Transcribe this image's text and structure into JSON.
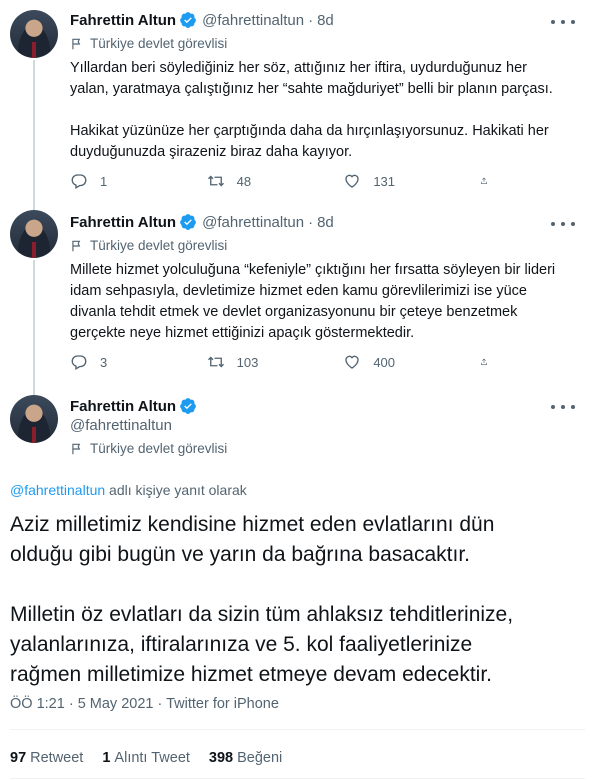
{
  "tweets": [
    {
      "name": "Fahrettin Altun",
      "handle": "@fahrettinaltun",
      "separator": "·",
      "time": "8d",
      "label": "Türkiye devlet görevlisi",
      "text": "Yıllardan beri söylediğiniz her söz, attığınız her iftira, uydurduğunuz her\nyalan, yaratmaya çalıştığınız her “sahte mağduriyet” belli bir planın parçası.\n\nHakikat yüzünüze her çarptığında daha da hırçınlaşıyorsunuz. Hakikati her\nduyduğunuzda şirazeniz biraz daha kayıyor.",
      "replies": "1",
      "retweets": "48",
      "likes": "131"
    },
    {
      "name": "Fahrettin Altun",
      "handle": "@fahrettinaltun",
      "separator": "·",
      "time": "8d",
      "label": "Türkiye devlet görevlisi",
      "text": "Millete hizmet yolculuğuna “kefeniyle” çıktığını her fırsatta söyleyen bir lideri\nidam sehpasıyla, devletimize hizmet eden kamu görevlilerimizi ise yüce\ndivanla tehdit etmek ve devlet organizasyonunu bir çeteye benzetmek\ngerçekte neye hizmet ettiğinizi apaçık göstermektedir.",
      "replies": "3",
      "retweets": "103",
      "likes": "400"
    }
  ],
  "main_tweet": {
    "name": "Fahrettin Altun",
    "handle": "@fahrettinaltun",
    "label": "Türkiye devlet görevlisi",
    "reply_mention": "@fahrettinaltun",
    "reply_suffix": " adlı kişiye yanıt olarak",
    "text": "Aziz milletimiz kendisine hizmet eden evlatlarını dün\nolduğu gibi bugün ve yarın da bağrına basacaktır.\n\nMilletin öz evlatları da sizin tüm ahlaksız tehditlerinize,\nyalanlarınıza, iftiralarınıza ve 5. kol faaliyetlerinize\nrağmen milletimize hizmet etmeye devam edecektir.",
    "meta": "ÖÖ 1:21 · 5 May 2021 · Twitter for iPhone",
    "retweet_count": "97",
    "retweet_label": "Retweet",
    "quote_count": "1",
    "quote_label": "Alıntı Tweet",
    "like_count": "398",
    "like_label": "Beğeni"
  },
  "icons": {
    "verified": "verified-badge-icon",
    "label_flag": "flag-icon",
    "reply": "reply-icon",
    "retweet": "retweet-icon",
    "like": "heart-icon",
    "share": "share-icon",
    "more": "more-options-icon"
  },
  "colors": {
    "accent": "#1d9bf0",
    "muted": "#536471",
    "text": "#0f1419",
    "thread_line": "#cfd9de"
  }
}
